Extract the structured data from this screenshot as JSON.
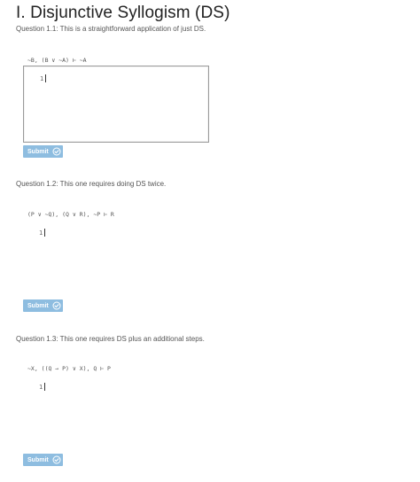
{
  "page": {
    "title": "I. Disjunctive Syllogism (DS)"
  },
  "questions": [
    {
      "label": "Question 1.1: This is a straightforward application of just DS.",
      "premises": "~B, (B ∨ ~A) ⊢ ~A",
      "first_line_number": "1",
      "submit_label": "Submit"
    },
    {
      "label": "Question 1.2: This one requires doing DS twice.",
      "premises": "(P ∨ ~Q), (Q ∨ R), ~P ⊢ R",
      "first_line_number": "1",
      "submit_label": "Submit"
    },
    {
      "label": "Question 1.3: This one requires DS plus an additional steps.",
      "premises": "~X, ((Q → P) ∨ X), Q ⊢ P",
      "first_line_number": "1",
      "submit_label": "Submit"
    }
  ],
  "icons": {
    "submit_icon": "check-circle-icon"
  },
  "colors": {
    "submit_bg": "#8ebde0",
    "submit_text": "#ffffff"
  }
}
